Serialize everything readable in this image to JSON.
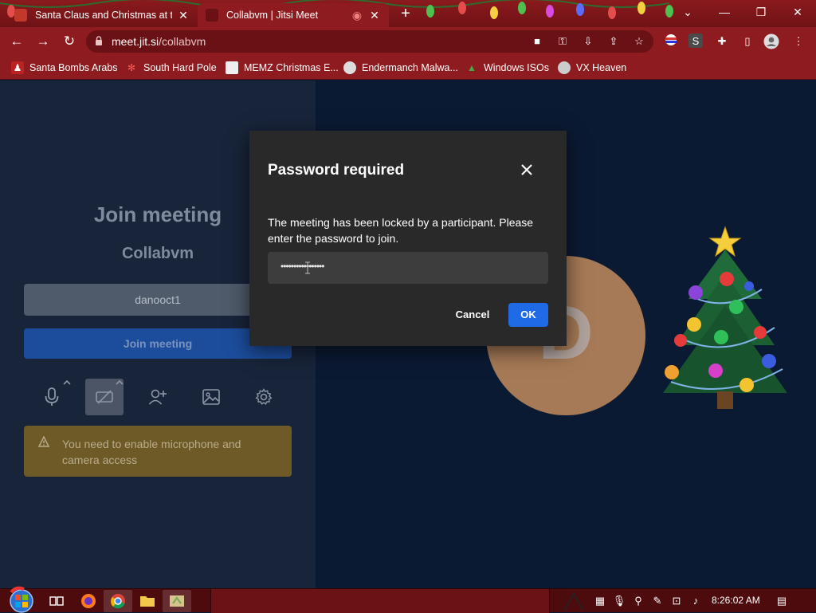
{
  "browser": {
    "tabs": [
      {
        "title": "Santa Claus and Christmas at the",
        "active": false
      },
      {
        "title": "Collabvm | Jitsi Meet",
        "active": true
      }
    ],
    "url_host": "meet.jit.si",
    "url_path": "/collabvm",
    "bookmarks": [
      {
        "label": "Santa Bombs Arabs",
        "icon": "santa-icon"
      },
      {
        "label": "South Hard Pole",
        "icon": "snowflake-icon"
      },
      {
        "label": "MEMZ Christmas E...",
        "icon": "memz-icon"
      },
      {
        "label": "Endermanch Malwa...",
        "icon": "endermanch-icon"
      },
      {
        "label": "Windows ISOs",
        "icon": "tree-icon"
      },
      {
        "label": "VX Heaven",
        "icon": "vx-heaven-icon"
      }
    ],
    "extension_badge": "S"
  },
  "prejoin": {
    "title": "Join meeting",
    "room_name": "Collabvm",
    "display_name": "danooct1",
    "join_label": "Join meeting",
    "warning": "You need to enable microphone and camera access",
    "avatar_letter": "D"
  },
  "dialog": {
    "title": "Password required",
    "message": "The meeting has been locked by a participant. Please enter the password to join.",
    "password_mask": "•••••••••••••••••",
    "cancel_label": "Cancel",
    "ok_label": "OK"
  },
  "taskbar": {
    "clock": "8:26:02 AM"
  },
  "colors": {
    "theme_red": "#8d1b1f",
    "page_bg": "#0b1a33",
    "panel_bg": "#18243a",
    "dialog_bg": "#292929",
    "ok_blue": "#1f6ae6",
    "warning_bg": "#6d5a27",
    "avatar": "#a67a56"
  }
}
